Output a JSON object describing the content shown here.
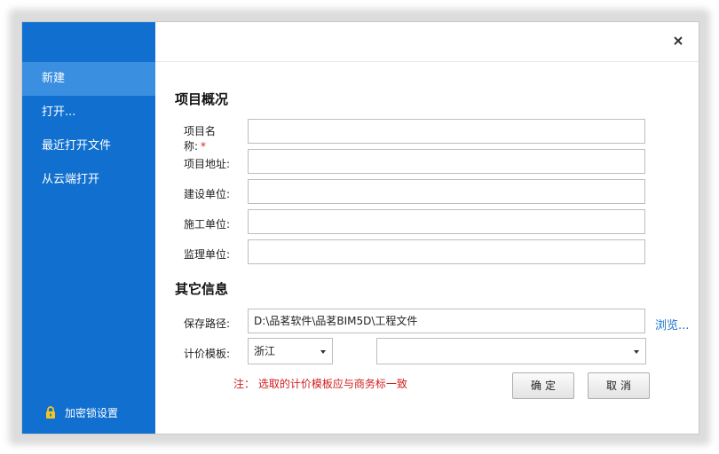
{
  "sidebar": {
    "items": [
      {
        "label": "新建",
        "active": true
      },
      {
        "label": "打开..."
      },
      {
        "label": "最近打开文件"
      },
      {
        "label": "从云端打开"
      }
    ],
    "lock_label": "加密锁设置"
  },
  "project": {
    "title": "项目概况",
    "fields": [
      {
        "label": "项目名称:",
        "required_mark": "*",
        "value": ""
      },
      {
        "label": "项目地址:",
        "value": ""
      },
      {
        "label": "建设单位:",
        "value": ""
      },
      {
        "label": "施工单位:",
        "value": ""
      },
      {
        "label": "监理单位:",
        "value": ""
      }
    ]
  },
  "other": {
    "title": "其它信息",
    "save_path_label": "保存路径:",
    "save_path_value": "D:\\品茗软件\\品茗BIM5D\\工程文件",
    "browse_label": "浏览...",
    "template_label": "计价模板:",
    "region_value": "浙江",
    "template_value": "",
    "note": "注： 选取的计价模板应与商务标一致"
  },
  "buttons": {
    "ok": "确定",
    "cancel": "取消"
  },
  "colors": {
    "sidebar_bg": "#1170cf",
    "sidebar_active": "#3a8fe0",
    "link": "#1a73c9",
    "note": "#d01c1c"
  }
}
